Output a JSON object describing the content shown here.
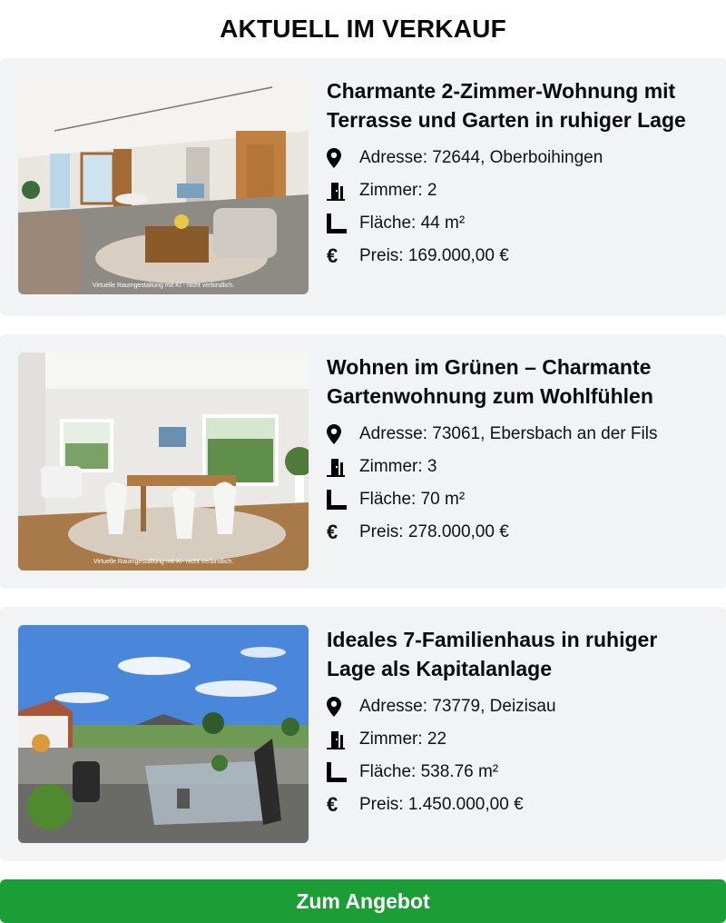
{
  "page": {
    "title": "AKTUELL IM VERKAUF"
  },
  "listings": [
    {
      "title": "Charmante 2-Zimmer-Wohnung mit Terrasse und Garten in ruhiger Lage",
      "address": "Adresse: 72644, Oberboihingen",
      "rooms": "Zimmer: 2",
      "area": "Fläche: 44 m²",
      "price": "Preis: 169.000,00 €",
      "image_caption": "Virtuelle Raumgestaltung mit KI - nicht verbindlich."
    },
    {
      "title": "Wohnen im Grünen – Charmante Gartenwohnung zum Wohlfühlen",
      "address": "Adresse: 73061, Ebersbach an der Fils",
      "rooms": "Zimmer: 3",
      "area": "Fläche: 70 m²",
      "price": "Preis: 278.000,00 €",
      "image_caption": "Virtuelle Raumgestaltung mit KI- nicht verbindlich."
    },
    {
      "title": "Ideales 7-Familienhaus in ruhiger Lage als Kapitalanlage",
      "address": "Adresse: 73779, Deizisau",
      "rooms": "Zimmer: 22",
      "area": "Fläche: 538.76 m²",
      "price": "Preis: 1.450.000,00 €",
      "image_caption": ""
    }
  ],
  "icons": {
    "address": "map-pin-icon",
    "rooms": "door-icon",
    "area": "ruler-icon",
    "price": "euro-icon",
    "euro_glyph": "€"
  },
  "cta": {
    "label": "Zum Angebot"
  },
  "colors": {
    "card_bg": "#f2f3f5",
    "cta_bg": "#1a9e35",
    "cta_text": "#ffffff"
  }
}
